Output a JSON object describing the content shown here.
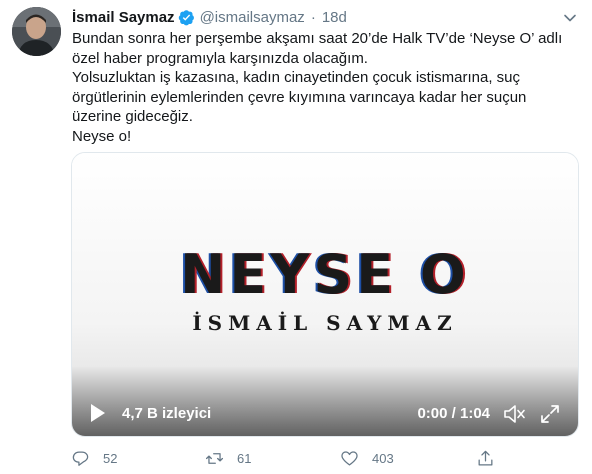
{
  "author": {
    "display_name": "İsmail Saymaz",
    "handle": "@ismailsaymaz",
    "separator": "·",
    "time": "18d"
  },
  "tweet": {
    "lines": [
      "Bundan sonra her perşembe akşamı saat 20’de Halk TV’de ‘Neyse O’ adlı\nözel haber programıyla karşınızda olacağım.",
      "Yolsuzluktan iş kazasına, kadın cinayetinden çocuk istismarına, suç\nörgütlerinin eylemlerinden çevre kıyımına varıncaya kadar her suçun\nüzerine gideceğiz.",
      "Neyse o!"
    ]
  },
  "video": {
    "title": "NEYSE O",
    "subtitle": "İSMAİL SAYMAZ",
    "views": "4,7 B izleyici",
    "timecode": "0:00 / 1:04"
  },
  "actions": {
    "reply_count": "52",
    "retweet_count": "61",
    "like_count": "403"
  },
  "icons": {
    "verified": "verified-badge-icon",
    "caret": "chevron-down-icon",
    "play": "play-icon",
    "volume": "volume-icon",
    "fullscreen": "fullscreen-icon",
    "reply": "reply-icon",
    "retweet": "retweet-icon",
    "like": "heart-icon",
    "share": "share-icon"
  },
  "colors": {
    "verified_blue": "#1da1f2",
    "secondary_text": "#657786"
  }
}
